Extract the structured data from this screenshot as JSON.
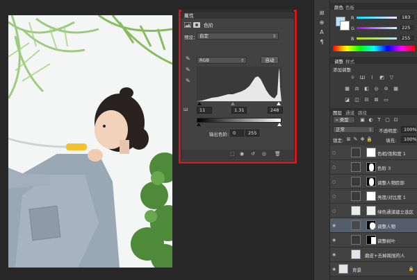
{
  "properties": {
    "tab_label": "属性",
    "panel_title": "色阶",
    "preset_label": "预设：",
    "preset_value": "自定",
    "channel_value": "RGB",
    "auto_button": "自动",
    "input_black": "11",
    "input_gamma": "1.31",
    "input_white": "248",
    "output_label": "输出色阶:",
    "output_black": "0",
    "output_white": "255"
  },
  "tools": {
    "items": [
      "history-icon",
      "text-icon",
      "character-icon",
      "paragraph-icon"
    ]
  },
  "color_panel": {
    "tab_color": "颜色",
    "tab_swatches": "色板",
    "r_label": "R",
    "g_label": "G",
    "b_label": "B",
    "r_value": "183",
    "g_value": "225",
    "b_value": "255",
    "foreground_color": "#b7e1ff"
  },
  "adjust_panel": {
    "tab_adjust": "调整",
    "tab_styles": "样式",
    "add_label": "添加调整"
  },
  "layers_panel": {
    "tab_layers": "图层",
    "tab_channels": "通道",
    "tab_paths": "路径",
    "filter_kind": "类型",
    "blend_mode": "正常",
    "opacity_label": "不透明度:",
    "opacity_value": "100%",
    "lock_label": "锁定:",
    "fill_label": "填充:",
    "fill_value": "100%",
    "layers": [
      {
        "name": "色相/饱和度 1"
      },
      {
        "name": "色阶 3"
      },
      {
        "name": "调整人物脸部"
      },
      {
        "name": "亮度/对比度 1"
      },
      {
        "name": "绿色通道建立选区"
      },
      {
        "name": "调整人物"
      },
      {
        "name": "调整树叶"
      },
      {
        "name": "磨皮+去掉周围的人"
      },
      {
        "name": "背景"
      }
    ]
  }
}
